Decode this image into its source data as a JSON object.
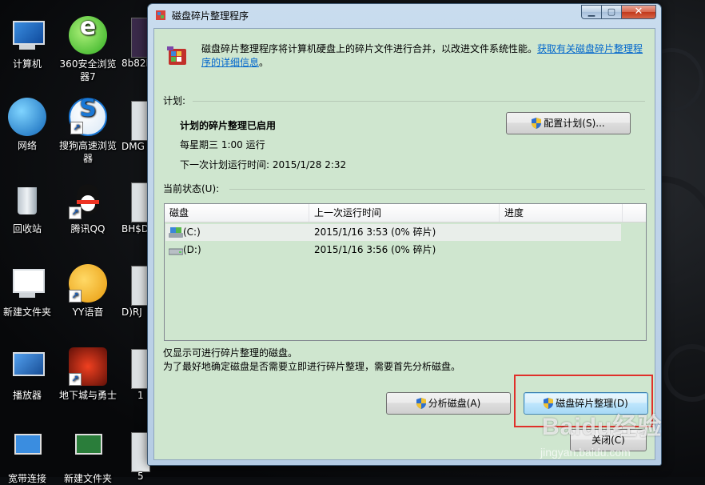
{
  "desktop": {
    "icons": [
      {
        "label": "计算机"
      },
      {
        "label": "360安全浏览器7"
      },
      {
        "label": "网络"
      },
      {
        "label": "搜狗高速浏览器"
      },
      {
        "label": "回收站"
      },
      {
        "label": "腾讯QQ"
      },
      {
        "label": "新建文件夹"
      },
      {
        "label": "YY语音"
      },
      {
        "label": "播放器"
      },
      {
        "label": "地下城与勇士"
      },
      {
        "label": "宽带连接"
      },
      {
        "label": "新建文件夹"
      }
    ],
    "partial_labels": [
      "8b82l",
      "DMG",
      "BH$D",
      "D)RJ",
      "1",
      "5"
    ]
  },
  "window": {
    "title": "磁盘碎片整理程序",
    "intro_text": "磁盘碎片整理程序将计算机硬盘上的碎片文件进行合并，以改进文件系统性能。",
    "intro_link": "获取有关磁盘碎片整理程序的详细信息",
    "intro_end": "。",
    "schedule": {
      "section_label": "计划:",
      "status": "计划的碎片整理已启用",
      "frequency": "每星期三 1:00 运行",
      "next_run": "下一次计划运行时间: 2015/1/28 2:32",
      "config_button": "配置计划(S)..."
    },
    "status_section": {
      "label": "当前状态(U):",
      "columns": [
        "磁盘",
        "上一次运行时间",
        "进度"
      ],
      "rows": [
        {
          "disk": "(C:)",
          "last_run": "2015/1/16 3:53 (0% 碎片)",
          "progress": ""
        },
        {
          "disk": "(D:)",
          "last_run": "2015/1/16 3:56 (0% 碎片)",
          "progress": ""
        }
      ]
    },
    "notes": [
      "仅显示可进行碎片整理的磁盘。",
      "为了最好地确定磁盘是否需要立即进行碎片整理，需要首先分析磁盘。"
    ],
    "buttons": {
      "analyze": "分析磁盘(A)",
      "defrag": "磁盘碎片整理(D)",
      "close": "关闭(C)"
    }
  },
  "watermark": {
    "main": "Baidu经验",
    "sub": "jingyan.baidu.com"
  },
  "colors": {
    "window_client": "#cfe6cf",
    "highlight_box": "#e0302a",
    "link": "#0066cc"
  }
}
